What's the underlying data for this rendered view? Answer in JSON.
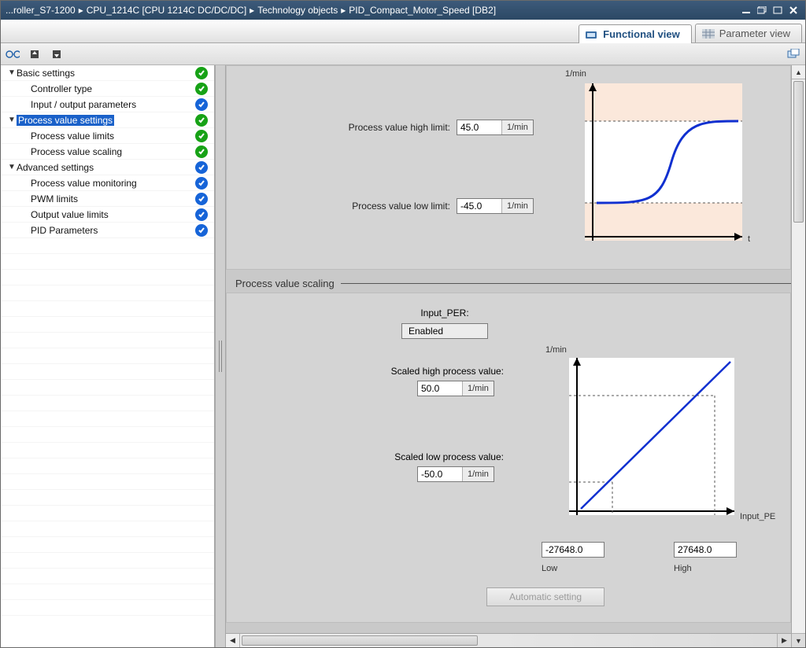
{
  "titlebar": {
    "segments": [
      "...roller_S7-1200",
      "CPU_1214C [CPU 1214C DC/DC/DC]",
      "Technology objects",
      "PID_Compact_Motor_Speed [DB2]"
    ]
  },
  "tabs": {
    "functional": "Functional view",
    "parameter": "Parameter view"
  },
  "sidebar": {
    "items": [
      {
        "label": "Basic settings",
        "level": 0,
        "expand": true,
        "badge": "green",
        "selected": false
      },
      {
        "label": "Controller type",
        "level": 1,
        "expand": false,
        "badge": "green",
        "selected": false
      },
      {
        "label": "Input / output parameters",
        "level": 1,
        "expand": false,
        "badge": "blue",
        "selected": false
      },
      {
        "label": "Process value settings",
        "level": 0,
        "expand": true,
        "badge": "green",
        "selected": true
      },
      {
        "label": "Process value limits",
        "level": 1,
        "expand": false,
        "badge": "green",
        "selected": false
      },
      {
        "label": "Process value scaling",
        "level": 1,
        "expand": false,
        "badge": "green",
        "selected": false
      },
      {
        "label": "Advanced settings",
        "level": 0,
        "expand": true,
        "badge": "blue",
        "selected": false
      },
      {
        "label": "Process value monitoring",
        "level": 1,
        "expand": false,
        "badge": "blue",
        "selected": false
      },
      {
        "label": "PWM limits",
        "level": 1,
        "expand": false,
        "badge": "blue",
        "selected": false
      },
      {
        "label": "Output value limits",
        "level": 1,
        "expand": false,
        "badge": "blue",
        "selected": false
      },
      {
        "label": "PID Parameters",
        "level": 1,
        "expand": false,
        "badge": "blue",
        "selected": false
      }
    ]
  },
  "limits": {
    "high_label": "Process value high limit:",
    "high_value": "45.0",
    "low_label": "Process value low limit:",
    "low_value": "-45.0",
    "unit": "1/min",
    "yaxis": "1/min",
    "xaxis": "t"
  },
  "scaling": {
    "header": "Process value scaling",
    "input_per_label": "Input_PER:",
    "input_per_value": "Enabled",
    "high_label": "Scaled high process value:",
    "high_value": "50.0",
    "low_label": "Scaled low process value:",
    "low_value": "-50.0",
    "unit": "1/min",
    "yaxis": "1/min",
    "xaxis": "Input_PE",
    "per_low": "-27648.0",
    "per_high": "27648.0",
    "low_text": "Low",
    "high_text": "High",
    "auto_btn": "Automatic setting"
  },
  "chart_data": [
    {
      "type": "line",
      "title": "Process value limits",
      "ylabel": "1/min",
      "xlabel": "t",
      "y_high": 45.0,
      "y_low": -45.0,
      "description": "S-curve from low limit (-45) to high limit (45) over time"
    },
    {
      "type": "line",
      "title": "Process value scaling",
      "ylabel": "1/min",
      "xlabel": "Input_PER",
      "x": [
        -27648.0,
        27648.0
      ],
      "y": [
        -50.0,
        50.0
      ],
      "x_ticks": {
        "Low": -27648.0,
        "High": 27648.0
      },
      "y_ticks": {
        "Scaled low": -50.0,
        "Scaled high": 50.0
      }
    }
  ]
}
